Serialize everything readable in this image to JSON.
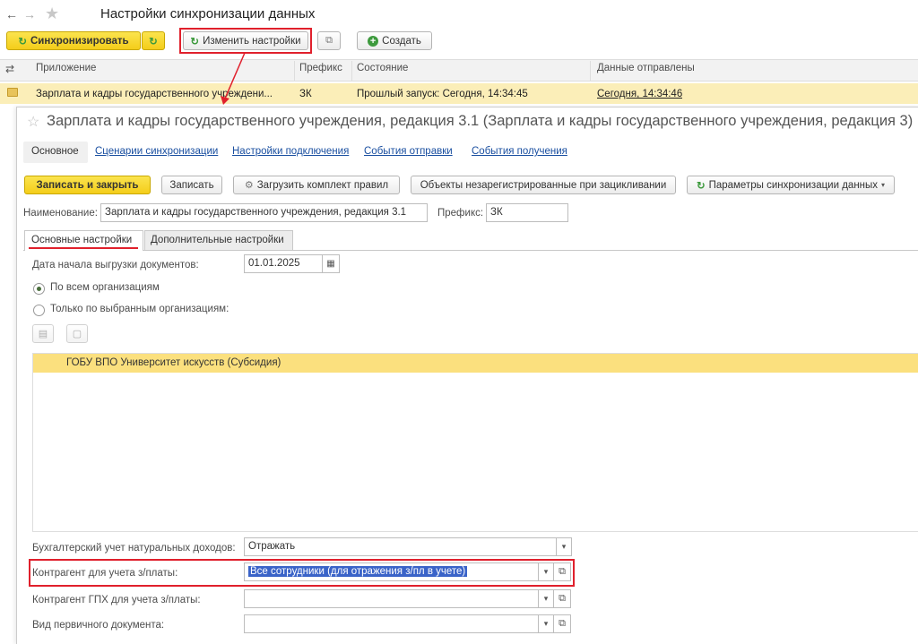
{
  "window": {
    "title": "Настройки синхронизации данных"
  },
  "toolbar": {
    "sync_label": "Синхронизировать",
    "change_settings_label": "Изменить настройки",
    "create_label": "Создать"
  },
  "table": {
    "columns": {
      "app": "Приложение",
      "prefix": "Префикс",
      "state": "Состояние",
      "sent": "Данные отправлены"
    },
    "row": {
      "app": "Зарплата и кадры государственного учреждени...",
      "prefix": "ЗК",
      "state": "Прошлый запуск: Сегодня, 14:34:45",
      "sent": "Сегодня, 14:34:46"
    }
  },
  "form": {
    "title": "Зарплата и кадры государственного учреждения, редакция 3.1 (Зарплата и кадры государственного учреждения, редакция 3)",
    "nav": {
      "main": "Основное",
      "scenarios": "Сценарии синхронизации",
      "connection": "Настройки подключения",
      "send_events": "События отправки",
      "receive_events": "События получения"
    },
    "buttons": {
      "save_close": "Записать и закрыть",
      "save": "Записать",
      "load_rules": "Загрузить комплект правил",
      "unregistered": "Объекты незарегистрированные при зацикливании",
      "params": "Параметры синхронизации данных"
    },
    "name_label": "Наименование:",
    "name_value": "Зарплата и кадры государственного учреждения, редакция 3.1",
    "prefix_label": "Префикс:",
    "prefix_value": "ЗК",
    "tabs": {
      "basic": "Основные настройки",
      "extra": "Дополнительные настройки"
    },
    "start_date_label": "Дата начала выгрузки документов:",
    "start_date_value": "01.01.2025",
    "radio_all": "По всем организациям",
    "radio_selected": "Только по выбранным организациям:",
    "org_row": "ГОБУ ВПО Университет искусств (Субсидия)",
    "natural_income_label": "Бухгалтерский учет натуральных доходов:",
    "natural_income_value": "Отражать",
    "counterparty_label": "Контрагент для учета з/платы:",
    "counterparty_value": "Все сотрудники (для отражения з/пл в учете)",
    "gph_label": "Контрагент ГПХ для учета з/платы:",
    "gph_value": "",
    "doc_type_label": "Вид первичного документа:",
    "doc_type_value": ""
  },
  "colors": {
    "accent_yellow": "#f4cd1a",
    "row_highlight": "#fbeeb8",
    "annotation_red": "#e0202c",
    "link_blue": "#1a4fa0",
    "selection_blue": "#3a63c8"
  }
}
